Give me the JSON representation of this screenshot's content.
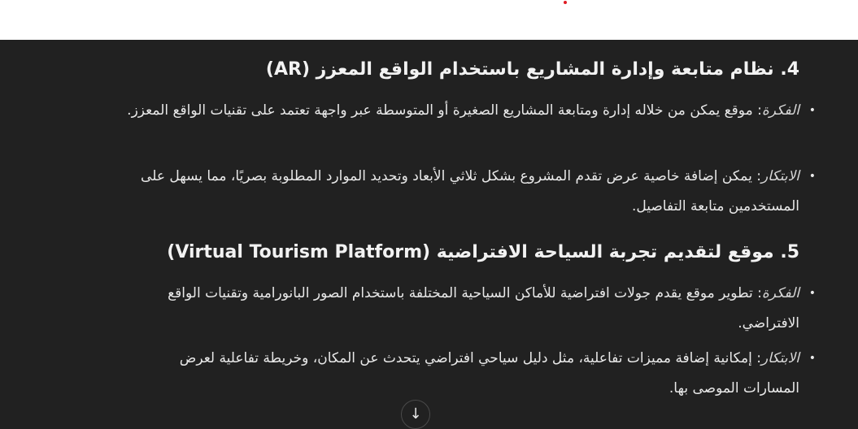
{
  "section4": {
    "heading": "4. نظام متابعة وإدارة المشاريع باستخدام الواقع المعزز (AR)",
    "items": [
      {
        "term": "الفكرة",
        "text": ": موقع يمكن من خلاله إدارة ومتابعة المشاريع الصغيرة أو المتوسطة عبر واجهة تعتمد على تقنيات الواقع المعزز."
      },
      {
        "term": "الابتكار",
        "text": ": يمكن إضافة خاصية عرض تقدم المشروع بشكل ثلاثي الأبعاد وتحديد الموارد المطلوبة بصريًا، مما يسهل على المستخدمين متابعة التفاصيل."
      }
    ]
  },
  "section5": {
    "heading": "5. موقع لتقديم تجربة السياحة الافتراضية (Virtual Tourism Platform)",
    "items": [
      {
        "term": "الفكرة",
        "text": ": تطوير موقع يقدم جولات افتراضية للأماكن السياحية المختلفة باستخدام الصور البانورامية وتقنيات الواقع الافتراضي."
      },
      {
        "term": "الابتكار",
        "text": ": إمكانية إضافة مميزات تفاعلية، مثل دليل سياحي افتراضي يتحدث عن المكان، وخريطة تفاعلية لعرض المسارات الموصى بها."
      }
    ]
  },
  "icons": {
    "scroll_down": "arrow-down-icon",
    "bullet": "•",
    "arrow": "↓"
  },
  "colors": {
    "background": "#212121",
    "text": "#ececec",
    "indicator": "#e01b24"
  }
}
